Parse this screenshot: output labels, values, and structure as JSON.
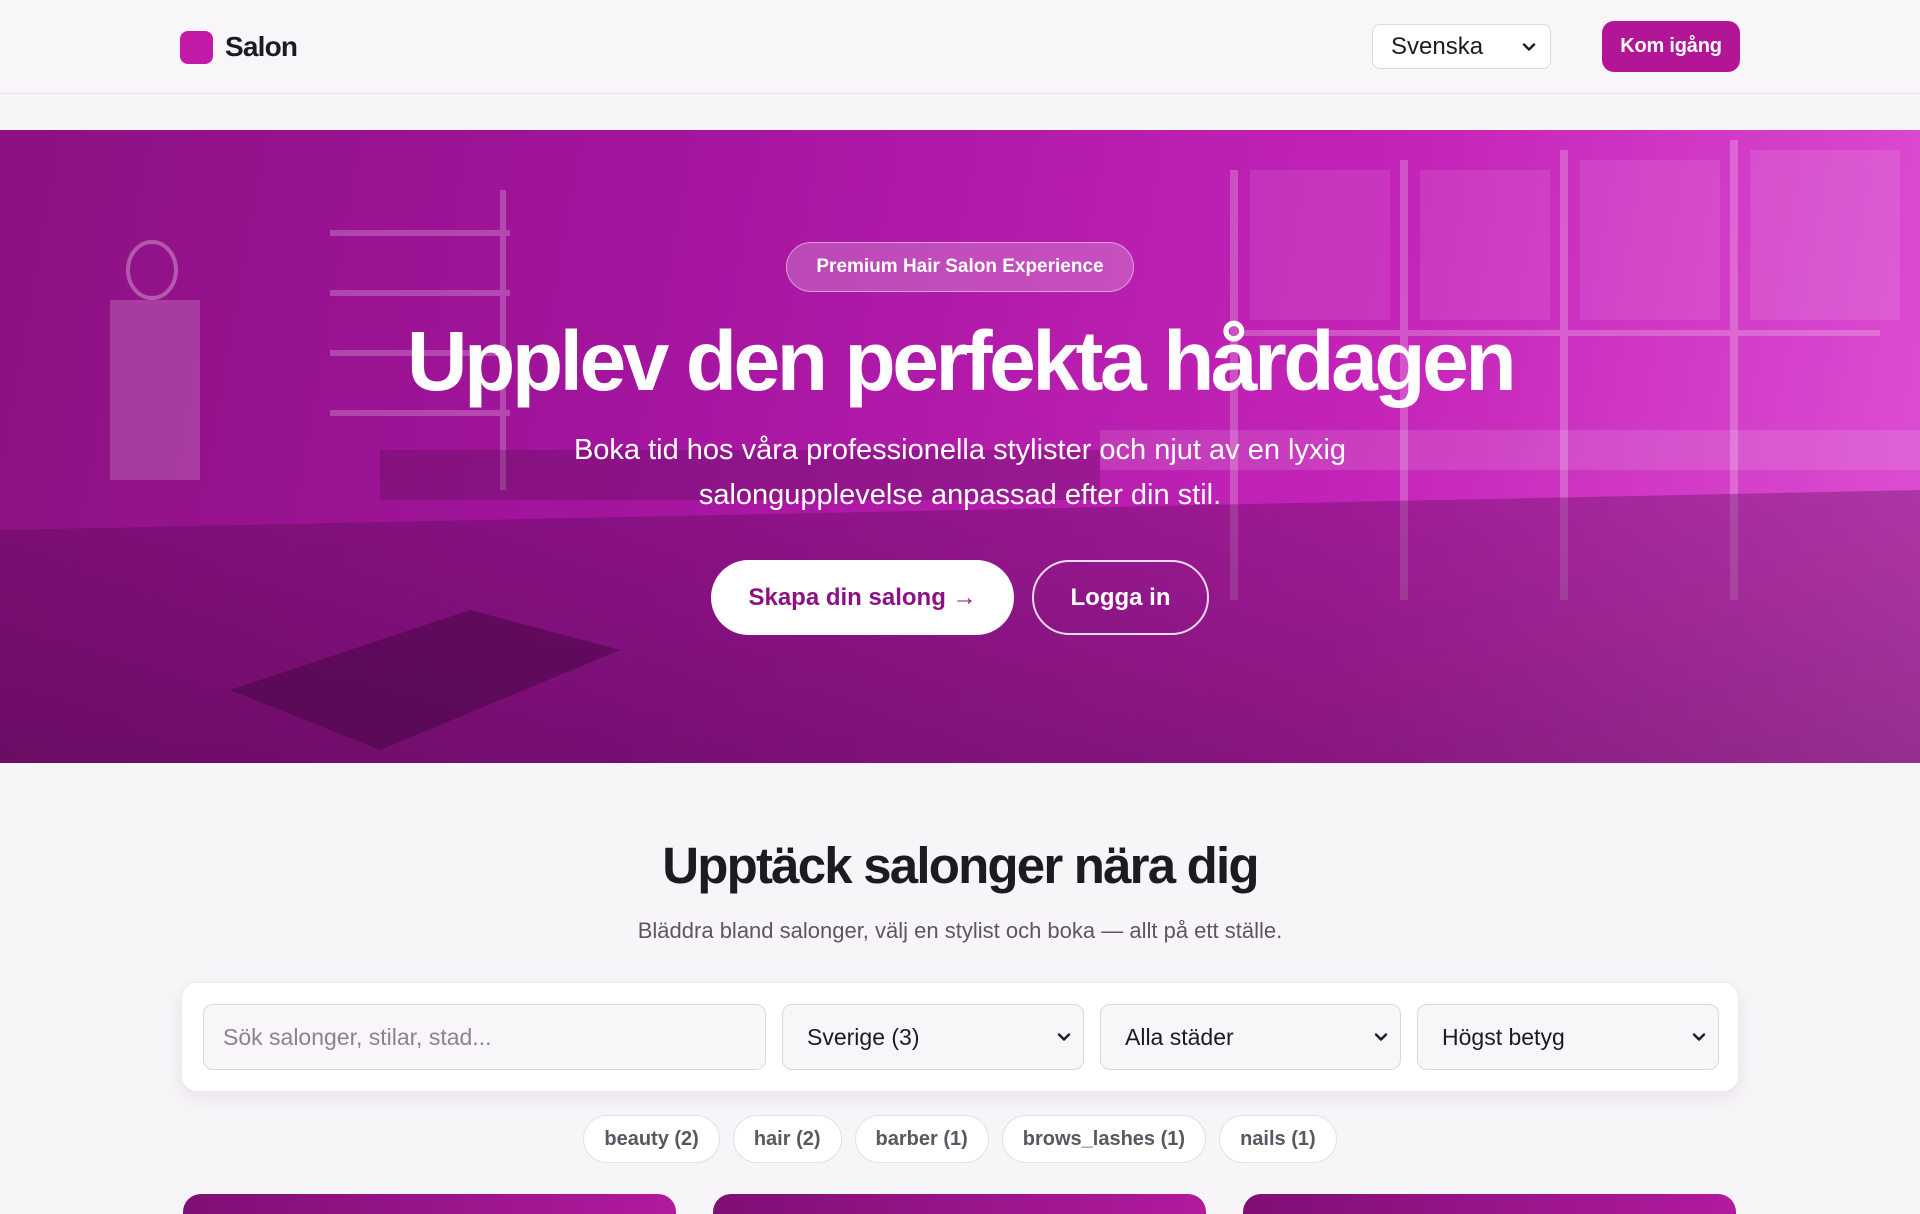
{
  "header": {
    "brand": "Salon",
    "language": "Svenska",
    "cta": "Kom igång"
  },
  "hero": {
    "badge": "Premium Hair Salon Experience",
    "title": "Upplev den perfekta hårdagen",
    "subtitle": "Boka tid hos våra professionella stylister och njut av en lyxig salongupplevelse anpassad efter din stil.",
    "primary_button": "Skapa din salong →",
    "secondary_button": "Logga in"
  },
  "discover": {
    "title": "Upptäck salonger nära dig",
    "subtitle": "Bläddra bland salonger, välj en stylist och boka — allt på ett ställe.",
    "search_placeholder": "Sök salonger, stilar, stad...",
    "country": "Sverige (3)",
    "city": "Alla städer",
    "sort": "Högst betyg",
    "categories": [
      "beauty (2)",
      "hair (2)",
      "barber (1)",
      "brows_lashes (1)",
      "nails (1)"
    ]
  },
  "colors": {
    "accent": "#b31597",
    "hero_gradient_start": "#8c1182",
    "hero_gradient_end": "#de50d4"
  }
}
